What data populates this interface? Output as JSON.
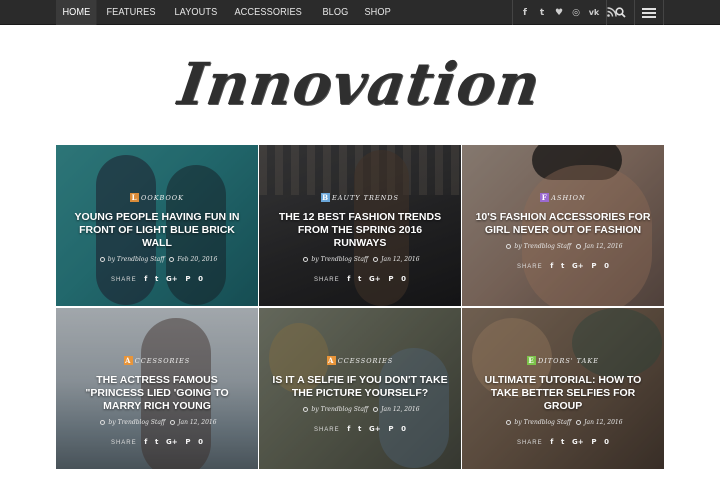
{
  "nav": {
    "items": [
      "HOME",
      "FEATURES",
      "LAYOUTS",
      "ACCESSORIES",
      "BLOG",
      "SHOP"
    ],
    "active": "HOME",
    "social_icons": [
      "facebook-icon",
      "twitter-icon",
      "heart-icon",
      "instagram-icon",
      "vk-icon",
      "rss-icon"
    ],
    "social_glyphs": [
      "f",
      "t",
      "♥",
      "◎",
      "vk",
      "☰"
    ]
  },
  "logo": {
    "text": "Innovation"
  },
  "posts": [
    {
      "category_letter": "L",
      "category": "ookbook",
      "category_color": "#d98c3a",
      "title": "Young people having fun in front of light blue brick wall",
      "author": "Trendblog Staff",
      "date": "Feb 20, 2016",
      "share_label": "SHARE",
      "share_icons": [
        "f",
        "t",
        "G+",
        "P",
        "0"
      ]
    },
    {
      "category_letter": "B",
      "category": "eauty trends",
      "category_color": "#6aa6d9",
      "title": "The 12 best fashion trends from the Spring 2016 runways",
      "author": "Trendblog Staff",
      "date": "Jan 12, 2016",
      "share_label": "SHARE",
      "share_icons": [
        "f",
        "t",
        "G+",
        "P",
        "0"
      ]
    },
    {
      "category_letter": "F",
      "category": "ashion",
      "category_color": "#9b6ad0",
      "title": "10's fashion accessories for girl never out of fashion",
      "author": "Trendblog Staff",
      "date": "Jan 12, 2016",
      "share_label": "SHARE",
      "share_icons": [
        "f",
        "t",
        "G+",
        "P",
        "0"
      ]
    },
    {
      "category_letter": "A",
      "category": "ccessories",
      "category_color": "#e8953a",
      "title": "The actress famous \"princess lied 'going to marry rich young",
      "author": "Trendblog Staff",
      "date": "Jan 12, 2016",
      "share_label": "SHARE",
      "share_icons": [
        "f",
        "t",
        "G+",
        "P",
        "0"
      ]
    },
    {
      "category_letter": "A",
      "category": "ccessories",
      "category_color": "#e8953a",
      "title": "Is it a selfie if you don't take the picture yourself?",
      "author": "Trendblog Staff",
      "date": "Jan 12, 2016",
      "share_label": "SHARE",
      "share_icons": [
        "f",
        "t",
        "G+",
        "P",
        "0"
      ]
    },
    {
      "category_letter": "E",
      "category": "ditors' take",
      "category_color": "#7cc24a",
      "title": "Ultimate tutorial: How to take better selfies for group",
      "author": "Trendblog Staff",
      "date": "Jan 12, 2016",
      "share_label": "SHARE",
      "share_icons": [
        "f",
        "t",
        "G+",
        "P",
        "0"
      ]
    }
  ]
}
